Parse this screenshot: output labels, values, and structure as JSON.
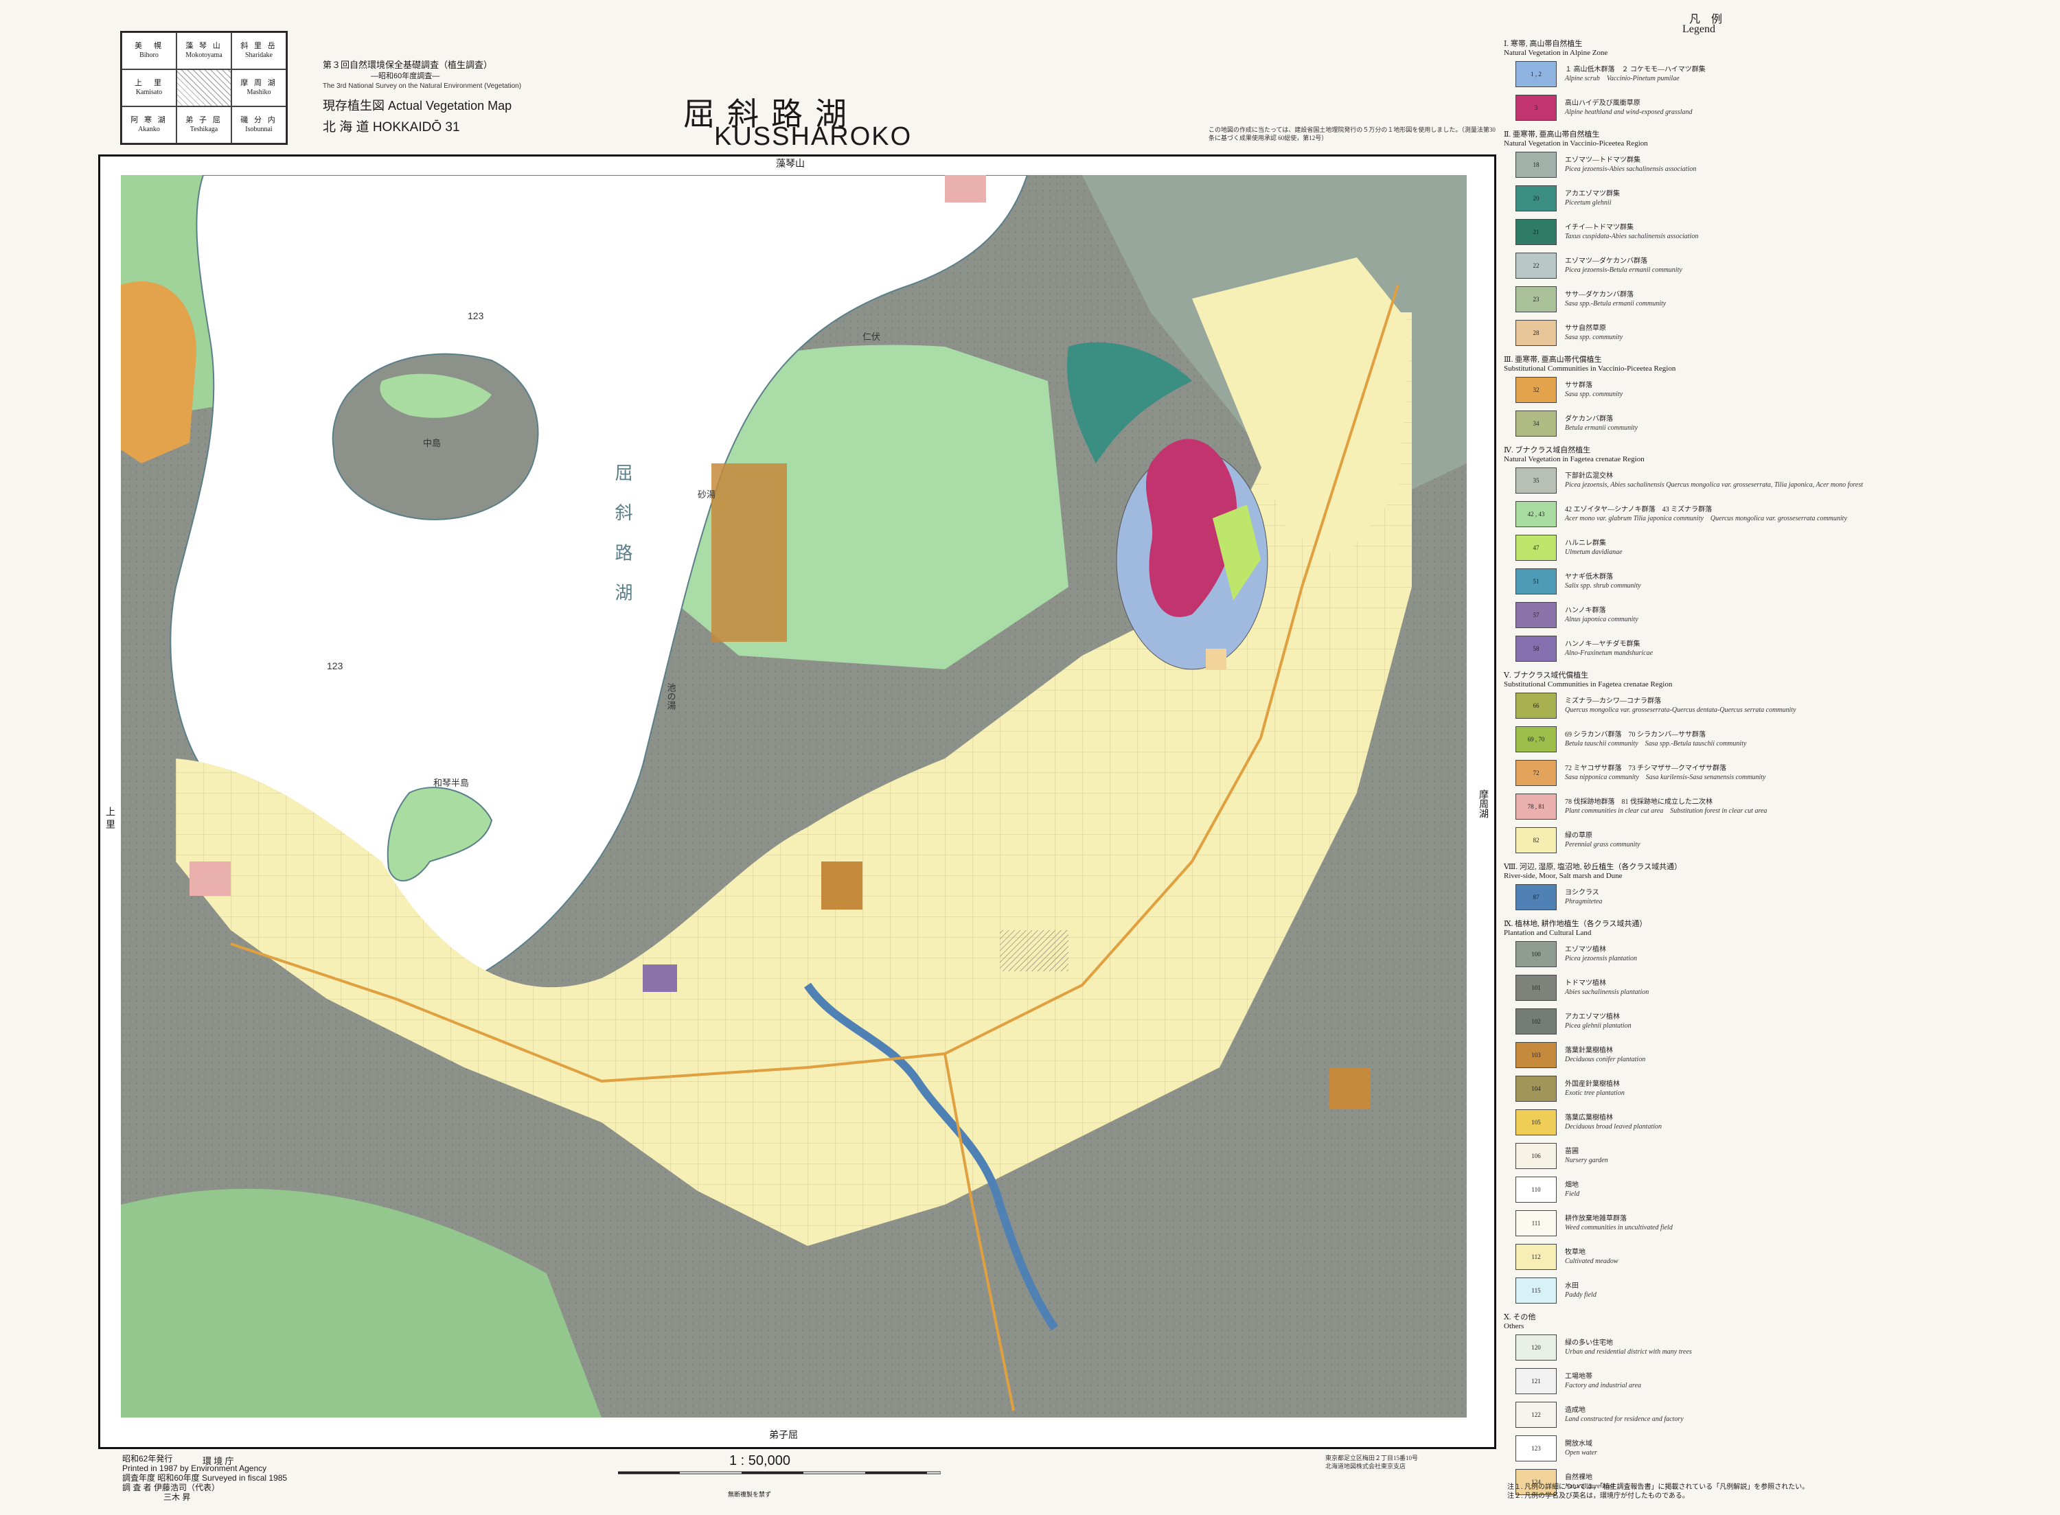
{
  "index_grid": [
    {
      "jp": "美　幌",
      "en": "Bihoro"
    },
    {
      "jp": "藻 琴 山",
      "en": "Mokotoyama"
    },
    {
      "jp": "斜 里 岳",
      "en": "Sharidake"
    },
    {
      "jp": "上　里",
      "en": "Kamisato"
    },
    {
      "jp": "",
      "en": ""
    },
    {
      "jp": "摩 周 湖",
      "en": "Mashiko"
    },
    {
      "jp": "阿 寒 湖",
      "en": "Akanko"
    },
    {
      "jp": "弟 子 屈",
      "en": "Teshikaga"
    },
    {
      "jp": "磯 分 内",
      "en": "Isobunnai"
    }
  ],
  "header": {
    "survey_jp": "第３回自然環境保全基礎調査（植生調査）",
    "survey_jp_sub": "―昭和60年度調査―",
    "survey_en": "The 3rd National Survey on the Natural Environment (Vegetation)",
    "map_type": "現存植生図  Actual Vegetation Map",
    "pref_sheet": "北 海 道  HOKKAIDŌ  31",
    "title_jp": "屈斜路湖",
    "title_en": "KUSSHAROKO",
    "note_top": "この地図の作成に当たっては、建設省国土地理院発行の５万分の１地形図を使用しました。（測量法第30条に基づく成果使用承認 60総使，第12号）"
  },
  "map": {
    "edge_top": "藻琴山",
    "edge_bottom": "弟子屈",
    "edge_left": "上 里",
    "edge_right": "摩周湖",
    "labels": {
      "lake_jp": "屈 斜 路 湖",
      "lake_code": "123",
      "lake_code2": "123",
      "nakajima": "中島",
      "wakoto": "和琴半島",
      "nibushi": "仁伏",
      "sunayu": "砂湯",
      "ikenoyu": "池の湯"
    }
  },
  "bottom": {
    "pub_lines": [
      "昭和62年発行",
      "Printed in 1987 by Environment Agency",
      "調査年度 昭和60年度  Surveyed in fiscal 1985",
      "調 査 者  伊藤浩司（代表）",
      "　　　　　三木  昇"
    ],
    "agency": "環 境 庁",
    "scale": "1 : 50,000",
    "scale_note": "無断複製を禁ず",
    "printer": "東京都足立区梅田２丁目15番10号\n北海道地図株式会社東京支店"
  },
  "legend": {
    "title_jp": "凡　例",
    "title_en": "Legend",
    "sections": [
      {
        "jp": "Ⅰ. 寒帯, 高山帯自然植生",
        "en": "Natural Vegetation in Alpine Zone",
        "items": [
          {
            "code": "1 , 2",
            "color": "#8fb3e0",
            "ja": "１ 高山低木群落　２ コケモモ―ハイマツ群集",
            "la": "Alpine scrub　Vaccinio-Pinetum pumilae"
          },
          {
            "code": "3",
            "color": "#c2346e",
            "ja": "高山ハイデ及び風衝草原",
            "la": "Alpine heathland and wind-exposed grassland"
          }
        ]
      },
      {
        "jp": "Ⅱ. 亜寒帯, 亜高山帯自然植生",
        "en": "Natural Vegetation in Vaccinio-Piceetea Region",
        "items": [
          {
            "code": "18",
            "color": "#9fb1a8",
            "ja": "エゾマツ―トドマツ群集",
            "la": "Picea jezoensis-Abies sachalinensis association"
          },
          {
            "code": "20",
            "color": "#3b8f82",
            "ja": "アカエゾマツ群集",
            "la": "Piceetum glehnii"
          },
          {
            "code": "21",
            "color": "#2f7b66",
            "ja": "イチイ―トドマツ群集",
            "la": "Taxus cuspidata-Abies sachalinensis association"
          },
          {
            "code": "22",
            "color": "#b7c8c7",
            "ja": "エゾマツ―ダケカンバ群落",
            "la": "Picea jezoensis-Betula ermanii community"
          },
          {
            "code": "23",
            "color": "#a9c29a",
            "ja": "ササ―ダケカンバ群落",
            "la": "Sasa spp.-Betula ermanii community"
          },
          {
            "code": "28",
            "color": "#e8c69a",
            "ja": "ササ自然草原",
            "la": "Sasa spp. community"
          }
        ]
      },
      {
        "jp": "Ⅲ. 亜寒帯, 亜高山帯代償植生",
        "en": "Substitutional Communities in Vaccinio-Piceetea Region",
        "items": [
          {
            "code": "32",
            "color": "#e3a24c",
            "ja": "ササ群落",
            "la": "Sasa spp. community"
          },
          {
            "code": "34",
            "color": "#b0ba83",
            "ja": "ダケカンバ群落",
            "la": "Betula ermanii community"
          }
        ]
      },
      {
        "jp": "Ⅳ. ブナクラス域自然植生",
        "en": "Natural Vegetation in Fagetea crenatae Region",
        "items": [
          {
            "code": "35",
            "color": "#b9c1b6",
            "ja": "下部針広混交林",
            "la": "Picea jezoensis, Abies sachalinensis Quercus mongolica var. grosseserrata, Tilia japonica, Acer mono forest"
          },
          {
            "code": "42 , 43",
            "color": "#a8dca0",
            "ja": "42 エゾイタヤ―シナノキ群落　43 ミズナラ群落",
            "la": "Acer mono var. glabrum Tilia japonica community　Quercus mongolica var. grosseserrata community"
          },
          {
            "code": "47",
            "color": "#bde66b",
            "ja": "ハルニレ群集",
            "la": "Ulmetum davidianae"
          },
          {
            "code": "51",
            "color": "#4d9bb7",
            "ja": "ヤナギ低木群落",
            "la": "Salix spp. shrub community"
          },
          {
            "code": "57",
            "color": "#8a73a8",
            "ja": "ハンノキ群落",
            "la": "Alnus japonica community"
          },
          {
            "code": "58",
            "color": "#8570b0",
            "ja": "ハンノキ―ヤチダモ群集",
            "la": "Alno-Fraxinetum mandshuricae"
          }
        ]
      },
      {
        "jp": "Ⅴ. ブナクラス域代償植生",
        "en": "Substitutional Communities in Fagetea crenatae Region",
        "items": [
          {
            "code": "66",
            "color": "#a8b150",
            "ja": "ミズナラ―カシワ―コナラ群落",
            "la": "Quercus mongolica var. grosseserrata-Quercus dentata-Quercus serrata community"
          },
          {
            "code": "69 , 70",
            "color": "#9bbf4a",
            "ja": "69 シラカンバ群落　70 シラカンバ―ササ群落",
            "la": "Betula tauschii community　Sasa spp.-Betula tauschii community"
          },
          {
            "code": "72",
            "color": "#e4a35a",
            "ja": "72 ミヤコザサ群落　73 チシマザサ―クマイザサ群落",
            "la": "Sasa nipponica community　Sasa kurilensis-Sasa senanensis community"
          },
          {
            "code": "78 , 81",
            "color": "#eab0ae",
            "ja": "78 伐採跡地群落　81 伐採跡地に成立した二次林",
            "la": "Plant communities in clear cut area　Substitution forest in clear cut area"
          },
          {
            "code": "82",
            "color": "#f6eeb1",
            "ja": "緑の草原",
            "la": "Perennial grass community"
          }
        ]
      },
      {
        "jp": "Ⅷ. 河辺, 湿原, 塩沼地, 砂丘植生（各クラス域共通）",
        "en": "River-side, Moor, Salt marsh and Dune",
        "items": [
          {
            "code": "87",
            "color": "#4f81b5",
            "ja": "ヨシクラス",
            "la": "Phragmitetea"
          }
        ]
      },
      {
        "jp": "Ⅸ. 植林地, 耕作地植生（各クラス域共通）",
        "en": "Plantation and Cultural Land",
        "items": [
          {
            "code": "100",
            "color": "#8f9c91",
            "ja": "エゾマツ植林",
            "la": "Picea jezoensis plantation"
          },
          {
            "code": "101",
            "color": "#7e827b",
            "ja": "トドマツ植林",
            "la": "Abies sachalinensis plantation"
          },
          {
            "code": "102",
            "color": "#757b75",
            "ja": "アカエゾマツ植林",
            "la": "Picea glehnii plantation"
          },
          {
            "code": "103",
            "color": "#c58a3c",
            "ja": "落葉針葉樹植林",
            "la": "Deciduous conifer plantation"
          },
          {
            "code": "104",
            "color": "#a1955a",
            "ja": "外国産針葉樹植林",
            "la": "Exotic tree plantation"
          },
          {
            "code": "105",
            "color": "#f0cd57",
            "ja": "落葉広葉樹植林",
            "la": "Deciduous broad leaved plantation"
          },
          {
            "code": "106",
            "color": "#f6f3e4",
            "ja": "苗圃",
            "la": "Nursery garden"
          },
          {
            "code": "110",
            "color": "#ffffff",
            "ja": "畑地",
            "la": "Field"
          },
          {
            "code": "111",
            "color": "#fbfaf0",
            "ja": "耕作放棄地雑草群落",
            "la": "Weed communities in uncultivated field"
          },
          {
            "code": "112",
            "color": "#f7eeb5",
            "ja": "牧草地",
            "la": "Cultivated meadow"
          },
          {
            "code": "115",
            "color": "#d7f2f7",
            "ja": "水田",
            "la": "Paddy field"
          }
        ]
      },
      {
        "jp": "Ⅹ. その他",
        "en": "Others",
        "items": [
          {
            "code": "120",
            "color": "#e8efe5",
            "ja": "緑の多い住宅地",
            "la": "Urban and residential district with many trees"
          },
          {
            "code": "121",
            "color": "#f1f1f1",
            "ja": "工場地帯",
            "la": "Factory and industrial area"
          },
          {
            "code": "122",
            "color": "#f4f4ec",
            "ja": "造成地",
            "la": "Land constructed for residence and factory"
          },
          {
            "code": "123",
            "color": "#ffffff",
            "ja": "開放水域",
            "la": "Open water"
          },
          {
            "code": "124",
            "color": "#f2d49a",
            "ja": "自然裸地",
            "la": "Natural bare land"
          }
        ]
      }
    ],
    "footnotes": [
      "注１. 凡例の詳細については，「植生調査報告書」に掲載されている「凡例解説」を参照されたい。",
      "注２. 凡例の学名及び英名は，環境庁が付したものである。"
    ]
  }
}
